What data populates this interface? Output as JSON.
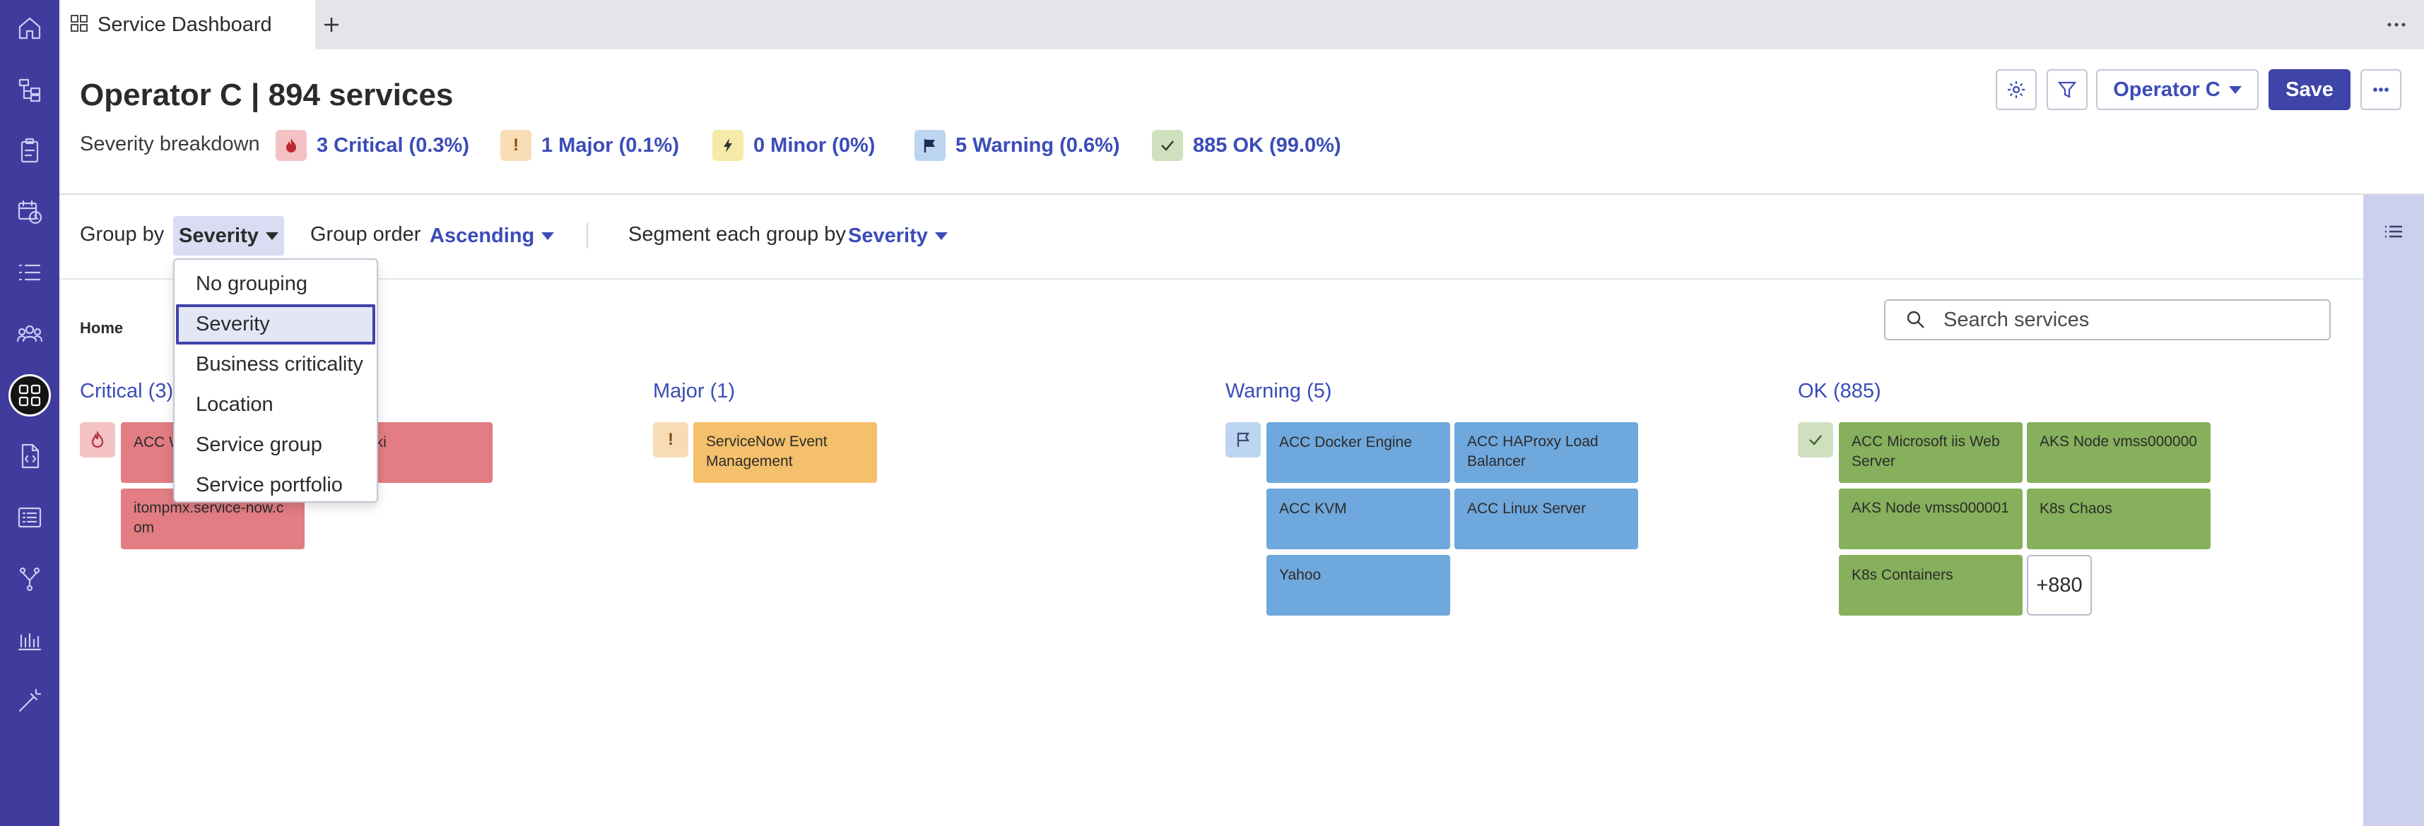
{
  "tab": {
    "title": "Service Dashboard",
    "icon": "dashboard-grid-icon"
  },
  "nav_icons": [
    "home-icon",
    "hierarchy-icon",
    "clipboard-icon",
    "calendar-clock-icon",
    "list-icon",
    "team-icon",
    "dashboard-icon",
    "code-file-icon",
    "report-list-icon",
    "branch-icon",
    "bar-chart-icon",
    "wand-icon"
  ],
  "header": {
    "title": "Operator C | 894 services",
    "breakdown_label": "Severity breakdown",
    "severities": [
      {
        "label": "3 Critical (0.3%)",
        "icon": "flame-icon",
        "color": "#f4c2c4"
      },
      {
        "label": "1 Major (0.1%)",
        "icon": "exclamation-icon",
        "color": "#f8dcb6"
      },
      {
        "label": "0 Minor (0%)",
        "icon": "bolt-icon",
        "color": "#f6eaa8"
      },
      {
        "label": "5 Warning (0.6%)",
        "icon": "flag-icon",
        "color": "#bcd5f0"
      },
      {
        "label": "885 OK (99.0%)",
        "icon": "check-icon",
        "color": "#cfe0bf"
      }
    ],
    "operator_label": "Operator C",
    "save_label": "Save"
  },
  "toolbar": {
    "group_by_label": "Group by",
    "group_by_value": "Severity",
    "group_order_label": "Group order",
    "group_order_value": "Ascending",
    "segment_label": "Segment each group by",
    "segment_value": "Severity"
  },
  "dropdown": {
    "options": [
      "No grouping",
      "Severity",
      "Business criticality",
      "Location",
      "Service group",
      "Service portfolio"
    ],
    "selected": "Severity"
  },
  "breadcrumb": "Home",
  "search": {
    "placeholder": "Search services"
  },
  "groups": {
    "critical": {
      "title": "Critical (3)",
      "tiles": [
        "ACC W",
        "iki",
        "itompmx.service-now.com"
      ]
    },
    "major": {
      "title": "Major (1)",
      "tiles": [
        "ServiceNow Event Management"
      ]
    },
    "warning": {
      "title": "Warning (5)",
      "tiles": [
        "ACC Docker Engine",
        "ACC HAProxy Load Balancer",
        "ACC KVM",
        "ACC Linux Server",
        "Yahoo"
      ]
    },
    "ok": {
      "title": "OK (885)",
      "tiles": [
        "ACC Microsoft iis Web Server",
        "AKS Node vmss000000",
        "AKS Node vmss000001",
        "K8s Chaos",
        "K8s Containers"
      ],
      "more": "+880"
    }
  }
}
